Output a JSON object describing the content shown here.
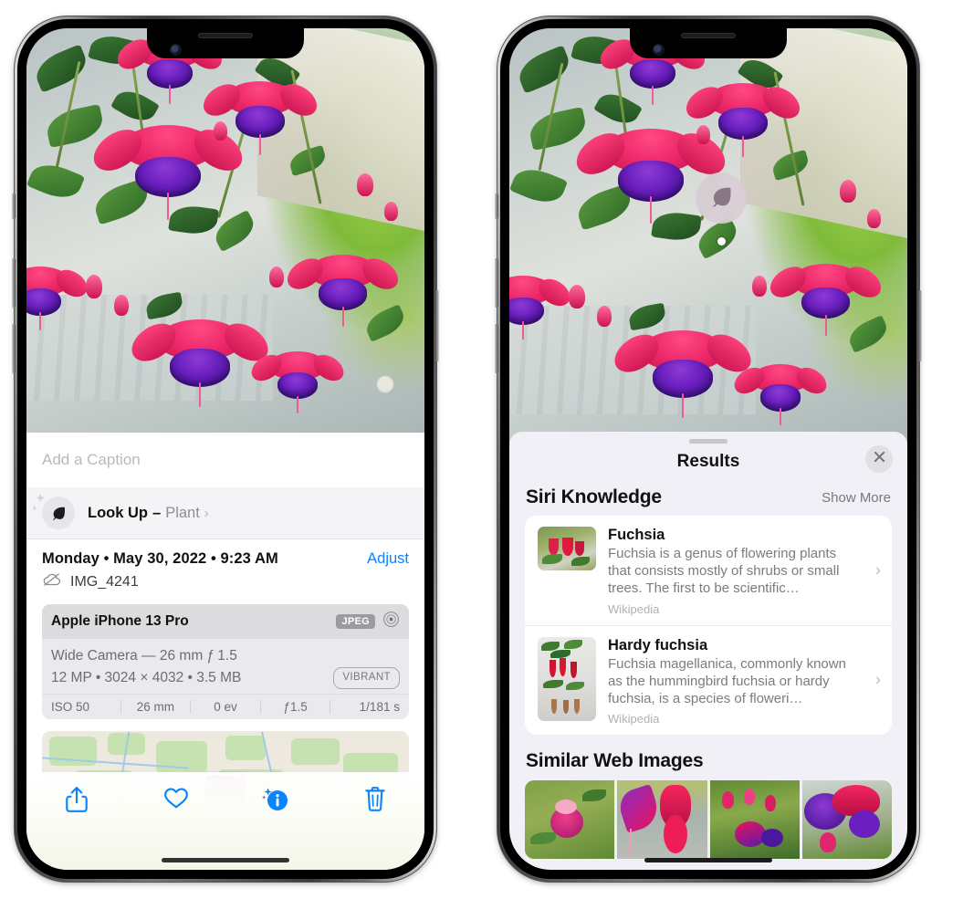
{
  "left_phone": {
    "caption_placeholder": "Add a Caption",
    "lookup": {
      "label": "Look Up",
      "dash": "–",
      "subject": "Plant",
      "chevron": "›",
      "icon": "leaf-icon"
    },
    "meta": {
      "date": "Monday • May 30, 2022 • 9:23 AM",
      "adjust_label": "Adjust",
      "filename": "IMG_4241",
      "cloud_icon": "icloud-slash-icon"
    },
    "camera": {
      "device": "Apple iPhone 13 Pro",
      "format_tag": "JPEG",
      "aperture_icon": "aperture-icon",
      "lens_line": "Wide Camera — 26 mm ƒ 1.5",
      "size_line": "12 MP • 3024 × 4032 • 3.5 MB",
      "style_tag": "VIBRANT",
      "exif": [
        "ISO 50",
        "26 mm",
        "0 ev",
        "ƒ1.5",
        "1/181 s"
      ]
    },
    "toolbar": [
      {
        "name": "share-button",
        "icon": "share-icon"
      },
      {
        "name": "favorite-button",
        "icon": "heart-icon"
      },
      {
        "name": "info-button",
        "icon": "info-sparkle-icon"
      },
      {
        "name": "delete-button",
        "icon": "trash-icon"
      }
    ]
  },
  "right_phone": {
    "lookup_badge_icon": "leaf-icon",
    "sheet": {
      "title": "Results",
      "close_icon": "close-icon",
      "siri": {
        "heading": "Siri Knowledge",
        "show_more": "Show More",
        "entries": [
          {
            "title": "Fuchsia",
            "description": "Fuchsia is a genus of flowering plants that consists mostly of shrubs or small trees. The first to be scientific…",
            "source": "Wikipedia",
            "chevron": "›"
          },
          {
            "title": "Hardy fuchsia",
            "description": "Fuchsia magellanica, commonly known as the hummingbird fuchsia or hardy fuchsia, is a species of floweri…",
            "source": "Wikipedia",
            "chevron": "›"
          }
        ]
      },
      "similar": {
        "heading": "Similar Web Images",
        "count": 4
      }
    }
  },
  "colors": {
    "accent_blue": "#0a84ff",
    "sheet_bg": "#f1f0f6",
    "card_bg": "#ffffff",
    "secondary_text": "#8e8e93",
    "camera_card": "#eaeaec"
  }
}
